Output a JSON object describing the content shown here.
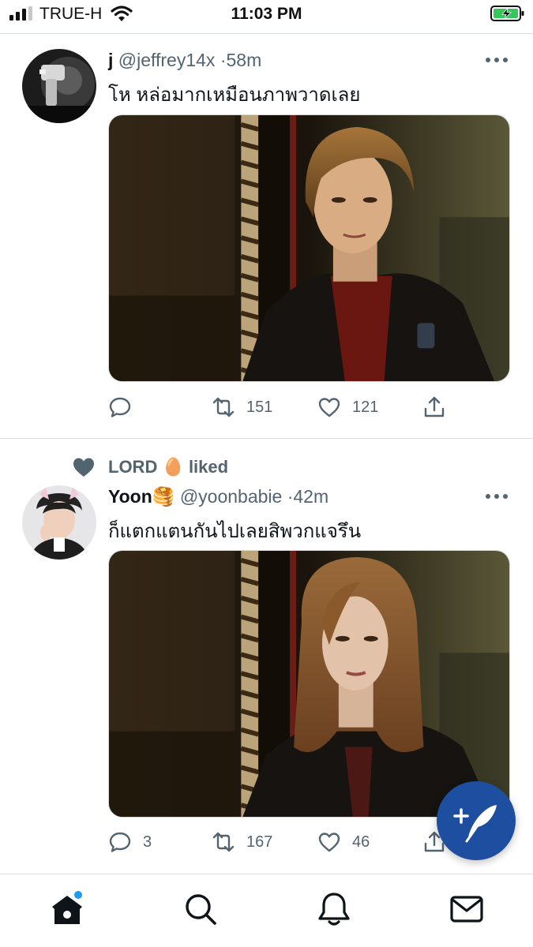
{
  "status_bar": {
    "carrier": "TRUE-H",
    "time": "11:03 PM"
  },
  "tweets": [
    {
      "display_name": "j",
      "handle": "@jeffrey14x",
      "separator": "·",
      "time_ago": "58m",
      "text": "โห หล่อมากเหมือนภาพวาดเลย",
      "replies": "",
      "retweets": "151",
      "likes": "121"
    },
    {
      "display_name": "Yoon🥞",
      "handle": "@yoonbabie",
      "separator": "·",
      "time_ago": "42m",
      "text": "ก็แตกแตนกันไปเลยสิพวกแจรึน",
      "replies": "3",
      "retweets": "167",
      "likes": "46"
    }
  ],
  "social_context": {
    "text": "LORD 🥚 liked"
  },
  "icons": {
    "status": [
      "signal-icon",
      "wifi-icon",
      "battery-charging-icon"
    ],
    "tweet_actions": [
      "reply-icon",
      "retweet-icon",
      "like-icon",
      "share-icon"
    ],
    "more": "more-options-icon",
    "fab": "compose-tweet-icon",
    "bottom_nav": [
      "home-icon",
      "search-icon",
      "notifications-icon",
      "messages-icon"
    ]
  },
  "colors": {
    "accent": "#1d4ea0",
    "secondary_text": "#536471",
    "primary_text": "#0f1419",
    "battery_green": "#35c759",
    "notification_dot": "#1d9bf0"
  }
}
